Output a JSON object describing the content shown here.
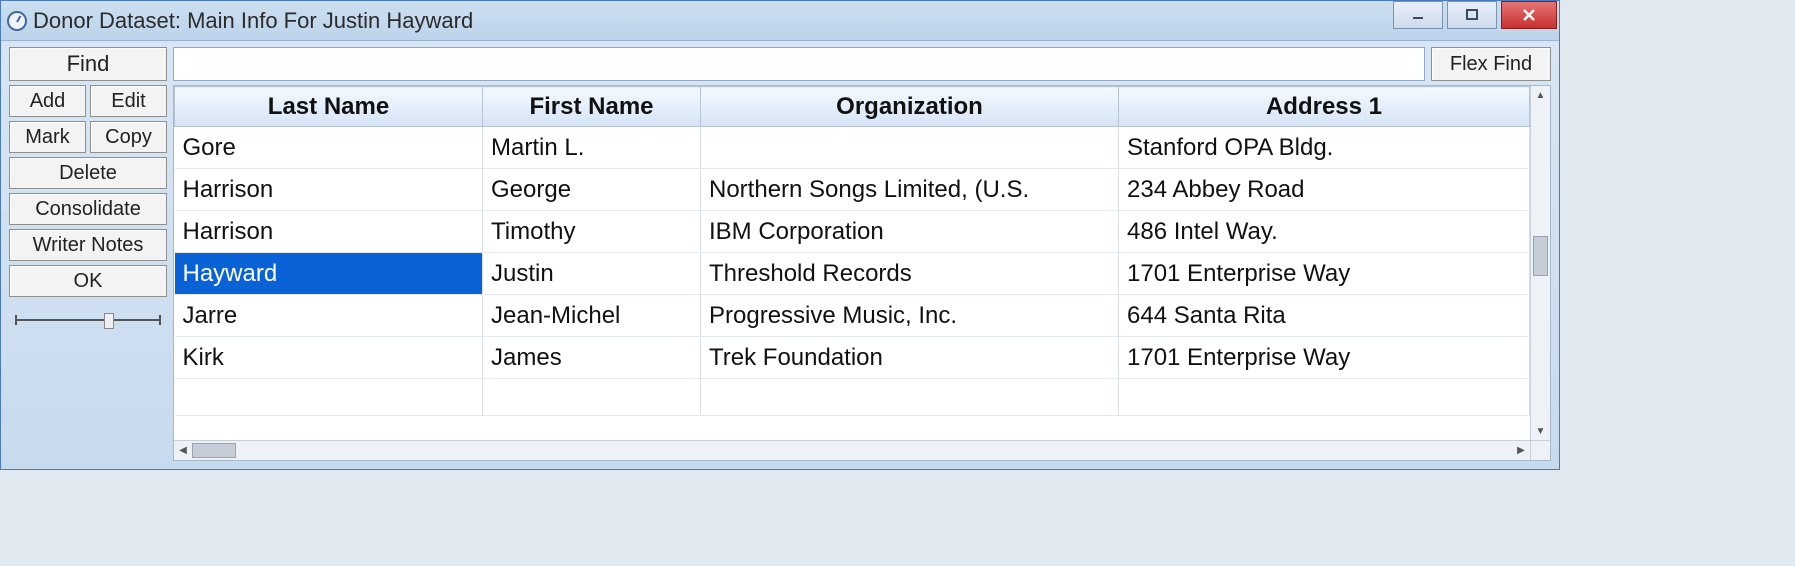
{
  "window": {
    "title": "Donor Dataset: Main Info For Justin Hayward"
  },
  "toolbar": {
    "find": "Find",
    "flex_find": "Flex Find",
    "search_value": ""
  },
  "sidebar": {
    "add": "Add",
    "edit": "Edit",
    "mark": "Mark",
    "copy": "Copy",
    "delete": "Delete",
    "consolidate": "Consolidate",
    "writer_notes": "Writer Notes",
    "ok": "OK"
  },
  "grid": {
    "columns": [
      "Last Name",
      "First Name",
      "Organization",
      "Address 1"
    ],
    "col_widths": [
      "308px",
      "218px",
      "418px",
      "auto"
    ],
    "selected_index": 3,
    "rows": [
      {
        "last": "Gore",
        "first": "Martin L.",
        "org": "",
        "addr": "Stanford OPA Bldg."
      },
      {
        "last": "Harrison",
        "first": "George",
        "org": "Northern Songs Limited, (U.S.",
        "addr": "234 Abbey Road"
      },
      {
        "last": "Harrison",
        "first": "Timothy",
        "org": "IBM Corporation",
        "addr": "486 Intel Way."
      },
      {
        "last": "Hayward",
        "first": "Justin",
        "org": "Threshold Records",
        "addr": "1701 Enterprise Way"
      },
      {
        "last": "Jarre",
        "first": "Jean-Michel",
        "org": "Progressive Music, Inc.",
        "addr": "644 Santa Rita"
      },
      {
        "last": "Kirk",
        "first": "James",
        "org": "Trek Foundation",
        "addr": "1701 Enterprise Way"
      }
    ]
  }
}
